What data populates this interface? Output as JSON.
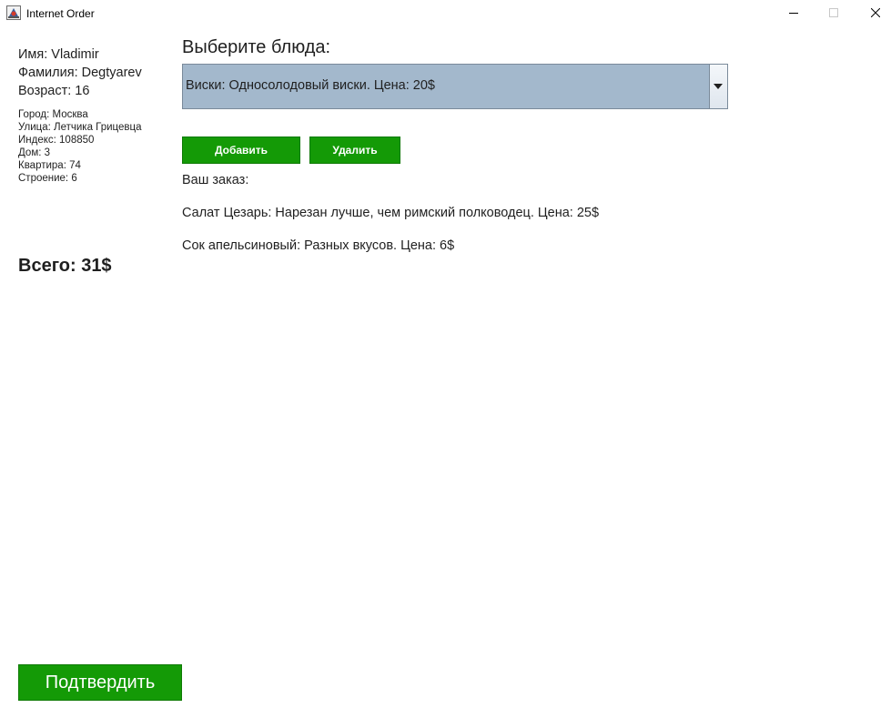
{
  "window": {
    "title": "Internet Order",
    "icon": "java-app-icon",
    "controls": [
      "minimize-icon",
      "maximize-icon",
      "close-icon"
    ]
  },
  "customer": {
    "name": "Имя: Vladimir",
    "surname": "Фамилия: Degtyarev",
    "age": "Возраст: 16",
    "address": {
      "city": "Город: Москва",
      "street": "Улица: Летчика Грицевца",
      "index": "Индекс: 108850",
      "house": "Дом: 3",
      "apartment": "Квартира: 74",
      "building": "Строение: 6"
    }
  },
  "total": "Всего: 31$",
  "menu": {
    "title": "Выберите блюда:",
    "selected": "Виски: Односолодовый виски. Цена: 20$"
  },
  "buttons": {
    "add": "Добавить",
    "remove": "Удалить",
    "confirm": "Подтвердить"
  },
  "order": {
    "label": "Ваш заказ:",
    "items": [
      "Салат Цезарь: Нарезан лучше, чем римский полководец. Цена: 25$",
      "Сок апельсиновый: Разных вкусов. Цена: 6$"
    ]
  },
  "colors": {
    "button_green": "#149a06",
    "combo_background": "#a3b8cc"
  }
}
